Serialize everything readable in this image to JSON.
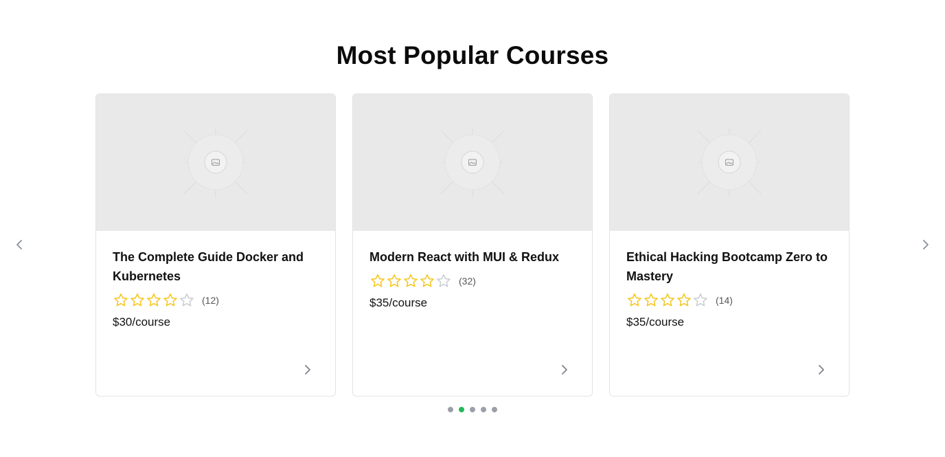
{
  "section": {
    "title": "Most Popular Courses"
  },
  "courses": [
    {
      "title": "The Complete Guide Docker and Kubernetes",
      "rating": 4,
      "max_rating": 5,
      "reviews": "(12)",
      "price": "$30/course"
    },
    {
      "title": "Modern React with MUI & Redux",
      "rating": 4,
      "max_rating": 5,
      "reviews": "(32)",
      "price": "$35/course"
    },
    {
      "title": "Ethical Hacking Bootcamp Zero to Mastery",
      "rating": 4,
      "max_rating": 5,
      "reviews": "(14)",
      "price": "$35/course"
    }
  ],
  "carousel": {
    "page_count": 5,
    "active_page": 2
  },
  "icons": {
    "prev": "chevron-left-icon",
    "next": "chevron-right-icon",
    "card_link": "chevron-right-icon",
    "image_placeholder": "image-icon",
    "star": "star-icon"
  },
  "colors": {
    "star_filled": "#f5c518",
    "star_empty": "#c8ccd2",
    "dot_active": "#22b85a",
    "dot_inactive": "#9aa0aa",
    "image_bg": "#e9e9e9"
  }
}
